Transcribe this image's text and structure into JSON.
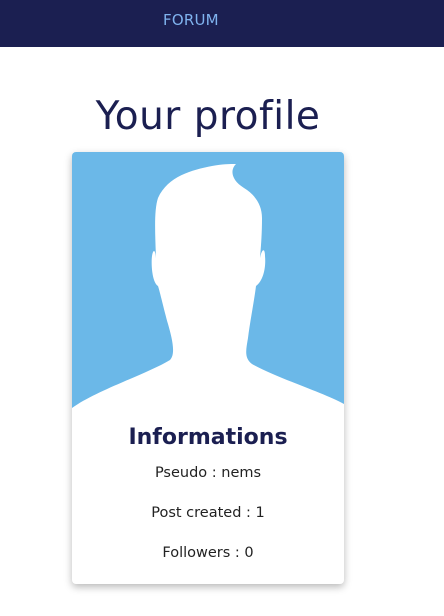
{
  "navbar": {
    "link_label": "FORUM",
    "background": "#1b1f51",
    "link_color": "#7fb2ee"
  },
  "page": {
    "title": "Your profile"
  },
  "profile_card": {
    "avatar_icon": "user-silhouette-icon",
    "avatar_background": "#6bb8e8",
    "heading": "Informations",
    "pseudo_line": "Pseudo : nems",
    "posts_line": "Post created : 1",
    "followers_line": "Followers : 0"
  }
}
